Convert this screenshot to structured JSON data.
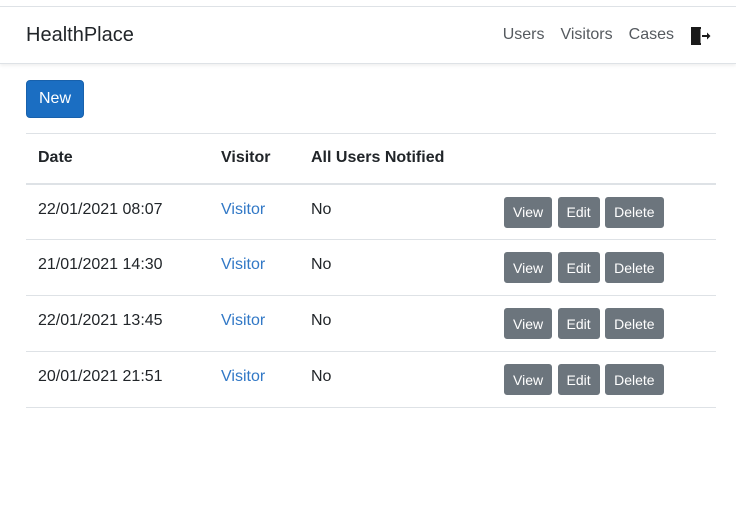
{
  "navbar": {
    "brand": "HealthPlace",
    "links": [
      "Users",
      "Visitors",
      "Cases"
    ],
    "logout_icon": "logout-icon"
  },
  "toolbar": {
    "new_label": "New"
  },
  "table": {
    "headers": [
      "Date",
      "Visitor",
      "All Users Notified",
      ""
    ],
    "rows": [
      {
        "date": "22/01/2021 08:07",
        "visitor": "Visitor",
        "notified": "No"
      },
      {
        "date": "21/01/2021 14:30",
        "visitor": "Visitor",
        "notified": "No"
      },
      {
        "date": "22/01/2021 13:45",
        "visitor": "Visitor",
        "notified": "No"
      },
      {
        "date": "20/01/2021 21:51",
        "visitor": "Visitor",
        "notified": "No"
      }
    ],
    "actions": {
      "view": "View",
      "edit": "Edit",
      "delete": "Delete"
    }
  },
  "colors": {
    "primary": "#1b6ec2",
    "secondary": "#6c757d",
    "link": "#3178c6"
  }
}
